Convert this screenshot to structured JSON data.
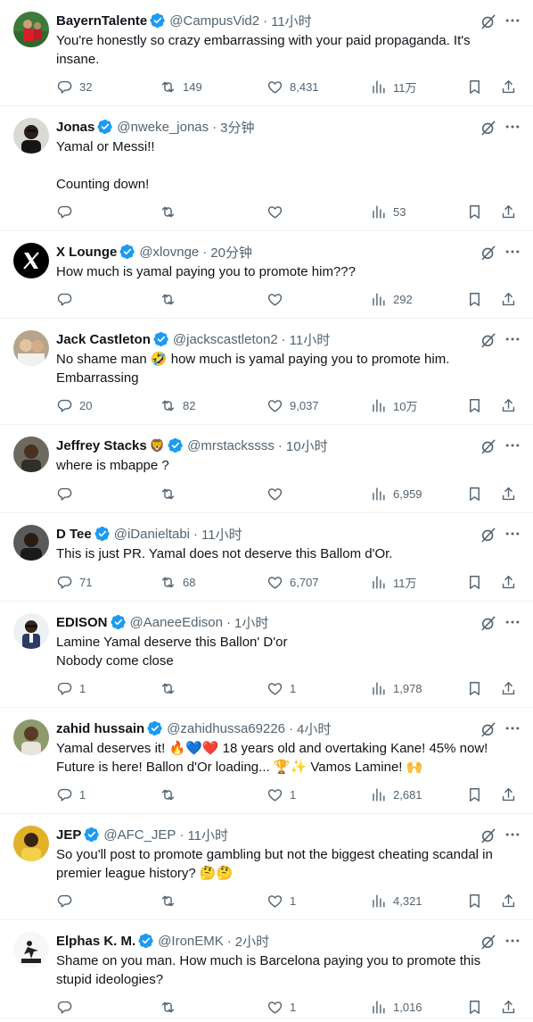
{
  "colors": {
    "verified": "#1d9bf0",
    "text": "#0f1419",
    "muted": "#536471",
    "divider": "#eff3f4"
  },
  "icons": {
    "verified": "verified-badge-icon",
    "grok": "grok-icon",
    "more": "more-icon",
    "reply": "reply-icon",
    "retweet": "retweet-icon",
    "like": "like-icon",
    "views": "views-icon",
    "bookmark": "bookmark-icon",
    "share": "share-icon"
  },
  "tweets": [
    {
      "name": "BayernTalente",
      "name_emoji": "",
      "handle": "@CampusVid2",
      "sep": "·",
      "time": "11小时",
      "text": "You're honestly so crazy embarrassing with your paid propaganda. It's insane.",
      "replies": "32",
      "retweets": "149",
      "likes": "8,431",
      "views": "11万"
    },
    {
      "name": "Jonas",
      "name_emoji": "",
      "handle": "@nweke_jonas",
      "sep": "·",
      "time": "3分钟",
      "text": "Yamal or Messi!!\n\nCounting down!",
      "replies": "",
      "retweets": "",
      "likes": "",
      "views": "53"
    },
    {
      "name": "X Lounge",
      "name_emoji": "",
      "handle": "@xlovnge",
      "sep": "·",
      "time": "20分钟",
      "text": "How much is yamal paying you to promote him???",
      "replies": "",
      "retweets": "",
      "likes": "",
      "views": "292"
    },
    {
      "name": "Jack Castleton",
      "name_emoji": "",
      "handle": "@jackscastleton2",
      "sep": "·",
      "time": "11小时",
      "text": "No shame man 🤣 how much is yamal paying you to promote him. Embarrassing",
      "replies": "20",
      "retweets": "82",
      "likes": "9,037",
      "views": "10万"
    },
    {
      "name": "Jeffrey Stacks",
      "name_emoji": "🦁",
      "handle": "@mrstackssss",
      "sep": "·",
      "time": "10小时",
      "text": "where is mbappe ?",
      "replies": "",
      "retweets": "",
      "likes": "",
      "views": "6,959"
    },
    {
      "name": "D Tee",
      "name_emoji": "",
      "handle": "@iDanieltabi",
      "sep": "·",
      "time": "11小时",
      "text": "This is just PR. Yamal does not deserve this Ballom d'Or.",
      "replies": "71",
      "retweets": "68",
      "likes": "6,707",
      "views": "11万"
    },
    {
      "name": "EDISON",
      "name_emoji": "",
      "handle": "@AaneeEdison",
      "sep": "·",
      "time": "1小时",
      "text": "Lamine Yamal deserve this Ballon' D'or\nNobody come close",
      "replies": "1",
      "retweets": "",
      "likes": "1",
      "views": "1,978"
    },
    {
      "name": "zahid hussain",
      "name_emoji": "",
      "handle": "@zahidhussa69226",
      "sep": "·",
      "time": "4小时",
      "text": "Yamal deserves it! 🔥💙❤️ 18 years old and overtaking Kane! 45% now! Future is here! Ballon d'Or loading... 🏆✨ Vamos Lamine! 🙌",
      "replies": "1",
      "retweets": "",
      "likes": "1",
      "views": "2,681"
    },
    {
      "name": "JEP",
      "name_emoji": "",
      "handle": "@AFC_JEP",
      "sep": "·",
      "time": "11小时",
      "text": "So you'll post to promote gambling but not the biggest cheating scandal in premier league history? 🤔🤔",
      "replies": "",
      "retweets": "",
      "likes": "1",
      "views": "4,321"
    },
    {
      "name": "Elphas K. M.",
      "name_emoji": "",
      "handle": "@IronEMK",
      "sep": "·",
      "time": "2小时",
      "text": "Shame on you man. How much is Barcelona paying you to promote this stupid ideologies?",
      "replies": "",
      "retweets": "",
      "likes": "1",
      "views": "1,016"
    }
  ]
}
